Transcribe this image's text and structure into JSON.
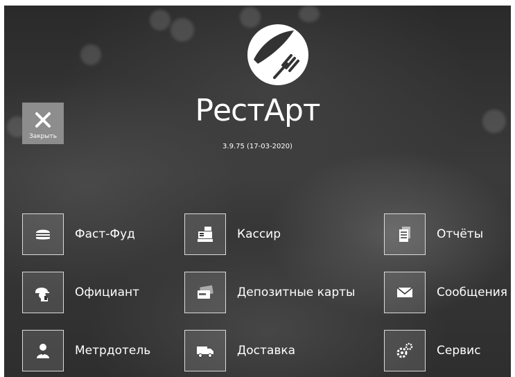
{
  "app": {
    "title": "РестАрт",
    "version": "3.9.75 (17-03-2020)",
    "logo_icon": "knife-fork-icon"
  },
  "close": {
    "label": "Закрыть",
    "icon": "close-icon"
  },
  "tiles": [
    {
      "label": "Фаст-Фуд",
      "icon": "burger-icon"
    },
    {
      "label": "Кассир",
      "icon": "cash-register-icon"
    },
    {
      "label": "Отчёты",
      "icon": "reports-icon"
    },
    {
      "label": "Официант",
      "icon": "waiter-icon"
    },
    {
      "label": "Депозитные карты",
      "icon": "card-icon"
    },
    {
      "label": "Сообщения",
      "icon": "envelope-icon"
    },
    {
      "label": "Метрдотель",
      "icon": "maitre-icon"
    },
    {
      "label": "Доставка",
      "icon": "truck-icon"
    },
    {
      "label": "Сервис",
      "icon": "gears-icon"
    }
  ],
  "colors": {
    "tile_text": "#ffffff",
    "close_bg": "#8d8d8d",
    "background": "#333333"
  }
}
